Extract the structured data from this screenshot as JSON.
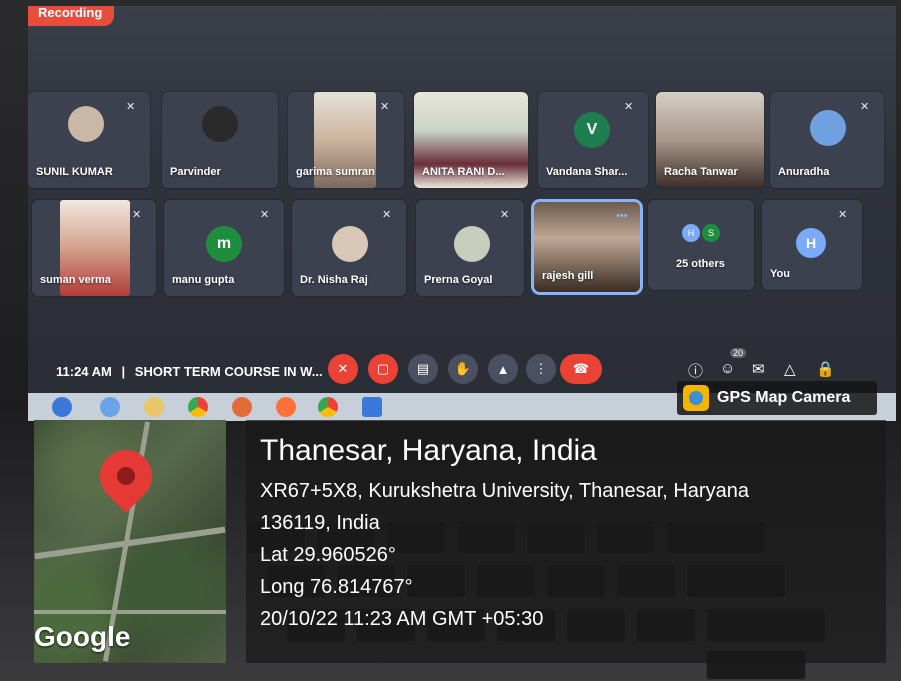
{
  "recording_label": "Recording",
  "participants": [
    {
      "name": "SUNIL KUMAR",
      "kind": "avatar-photo"
    },
    {
      "name": "Parvinder",
      "kind": "avatar-photo"
    },
    {
      "name": "garima sumran",
      "kind": "video"
    },
    {
      "name": "ANITA RANI D...",
      "kind": "video"
    },
    {
      "name": "Vandana Shar...",
      "kind": "avatar-letter",
      "letter": "V"
    },
    {
      "name": "Racha Tanwar",
      "kind": "video"
    },
    {
      "name": "Anuradha",
      "kind": "avatar-photo"
    },
    {
      "name": "suman verma",
      "kind": "video"
    },
    {
      "name": "manu gupta",
      "kind": "avatar-letter",
      "letter": "m"
    },
    {
      "name": "Dr. Nisha Raj",
      "kind": "avatar-photo"
    },
    {
      "name": "Prerna Goyal",
      "kind": "avatar-photo"
    },
    {
      "name": "rajesh gill",
      "kind": "video"
    },
    {
      "name": "25 others",
      "kind": "others"
    },
    {
      "name": "You",
      "kind": "avatar-letter",
      "letter": "H"
    }
  ],
  "others_letters": [
    "H",
    "S"
  ],
  "meeting": {
    "time": "11:24 AM",
    "separator": "|",
    "title": "SHORT TERM COURSE IN W..."
  },
  "people_count_badge": "20",
  "gps_camera_label": "GPS Map Camera",
  "map_logo": "Google",
  "location": {
    "place": "Thanesar, Haryana, India",
    "address_line1": "XR67+5X8, Kurukshetra University, Thanesar, Haryana",
    "address_line2": "136119, India",
    "lat": "Lat 29.960526°",
    "long": "Long 76.814767°",
    "datetime": "20/10/22 11:23 AM GMT +05:30"
  },
  "icons": {
    "mic_off": "mic-off-icon",
    "cam_off": "camera-off-icon",
    "captions": "captions-icon",
    "hand": "raise-hand-icon",
    "present": "present-icon",
    "more": "more-icon",
    "end": "end-call-icon",
    "info": "info-icon",
    "people": "people-icon",
    "chat": "chat-icon",
    "activities": "activities-icon",
    "lock": "host-controls-icon"
  },
  "colors": {
    "end_call": "#ea4335",
    "active_speaker": "#8ab4f8",
    "pin": "#e53935"
  }
}
